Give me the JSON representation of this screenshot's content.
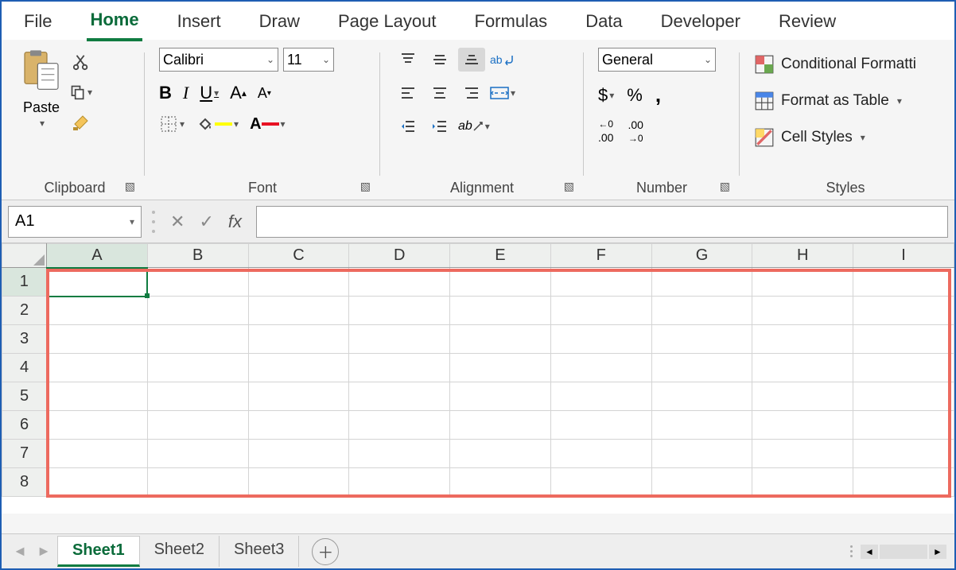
{
  "tabs": [
    "File",
    "Home",
    "Insert",
    "Draw",
    "Page Layout",
    "Formulas",
    "Data",
    "Developer",
    "Review"
  ],
  "active_tab": "Home",
  "clipboard": {
    "paste": "Paste",
    "group_label": "Clipboard"
  },
  "font": {
    "name": "Calibri",
    "size": "11",
    "bold": "B",
    "italic": "I",
    "underline": "U",
    "group_label": "Font"
  },
  "alignment": {
    "wrap": "ab",
    "group_label": "Alignment"
  },
  "number": {
    "format": "General",
    "currency": "$",
    "percent": "%",
    "comma": ",",
    "inc": ".00",
    "dec": ".00",
    "group_label": "Number"
  },
  "styles": {
    "conditional": "Conditional Formatti",
    "table": "Format as Table",
    "cell": "Cell Styles",
    "group_label": "Styles"
  },
  "namebox": "A1",
  "fx_label": "fx",
  "columns": [
    "A",
    "B",
    "C",
    "D",
    "E",
    "F",
    "G",
    "H",
    "I"
  ],
  "rows": [
    "1",
    "2",
    "3",
    "4",
    "5",
    "6",
    "7",
    "8"
  ],
  "selected_cell": "A1",
  "sheets": [
    "Sheet1",
    "Sheet2",
    "Sheet3"
  ],
  "active_sheet": "Sheet1"
}
